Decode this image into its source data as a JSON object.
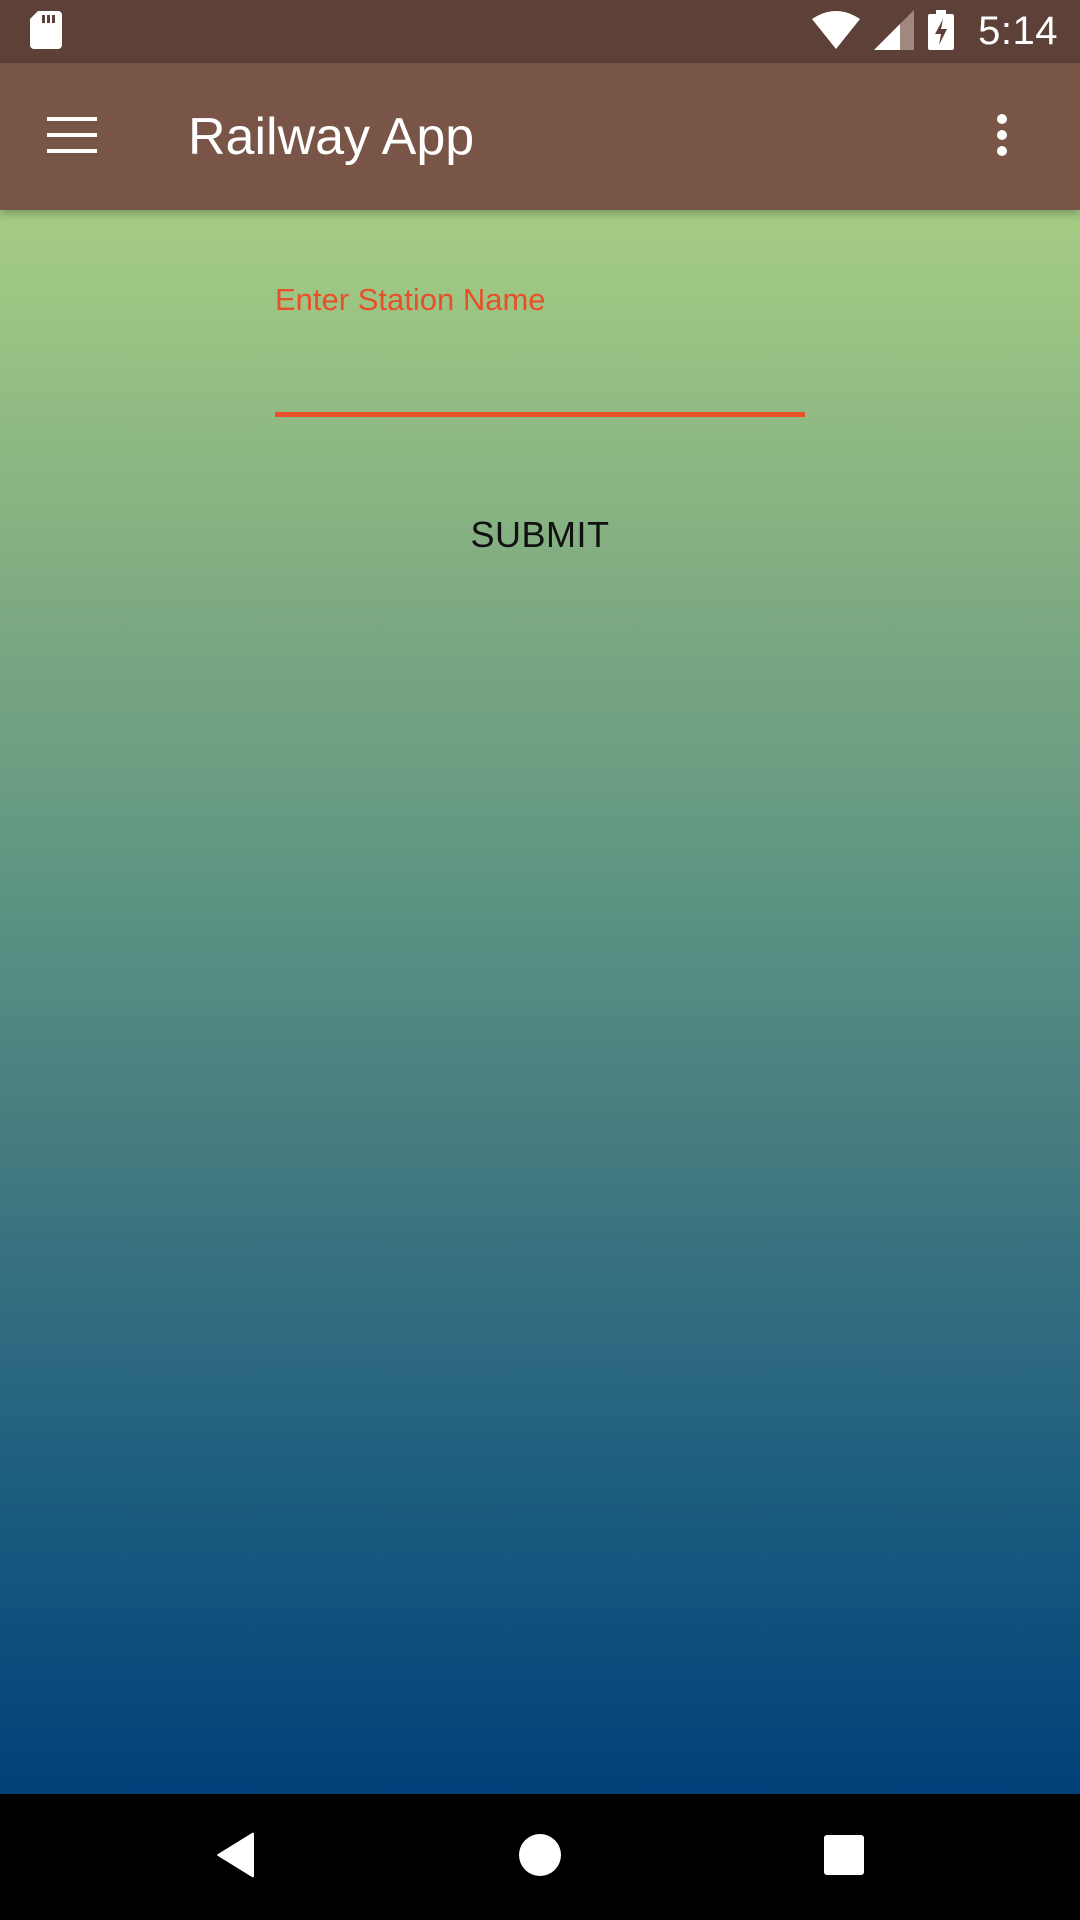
{
  "status_bar": {
    "time": "5:14",
    "icons": [
      "sd-card-icon",
      "wifi-icon",
      "cell-signal-icon",
      "battery-charging-icon"
    ],
    "color": "#5d4037"
  },
  "app_bar": {
    "title": "Railway App",
    "menu_icon": "hamburger-menu-icon",
    "overflow_icon": "more-vert-icon",
    "color": "#795548"
  },
  "form": {
    "station_field": {
      "label": "Enter Station Name",
      "value": "",
      "accent_color": "#e8502a"
    },
    "submit_label": "SUBMIT"
  },
  "background": {
    "gradient_top": "#a5cd84",
    "gradient_bottom": "#013f7a"
  },
  "nav_bar": {
    "icons": [
      "back-icon",
      "home-icon",
      "recents-icon"
    ]
  }
}
